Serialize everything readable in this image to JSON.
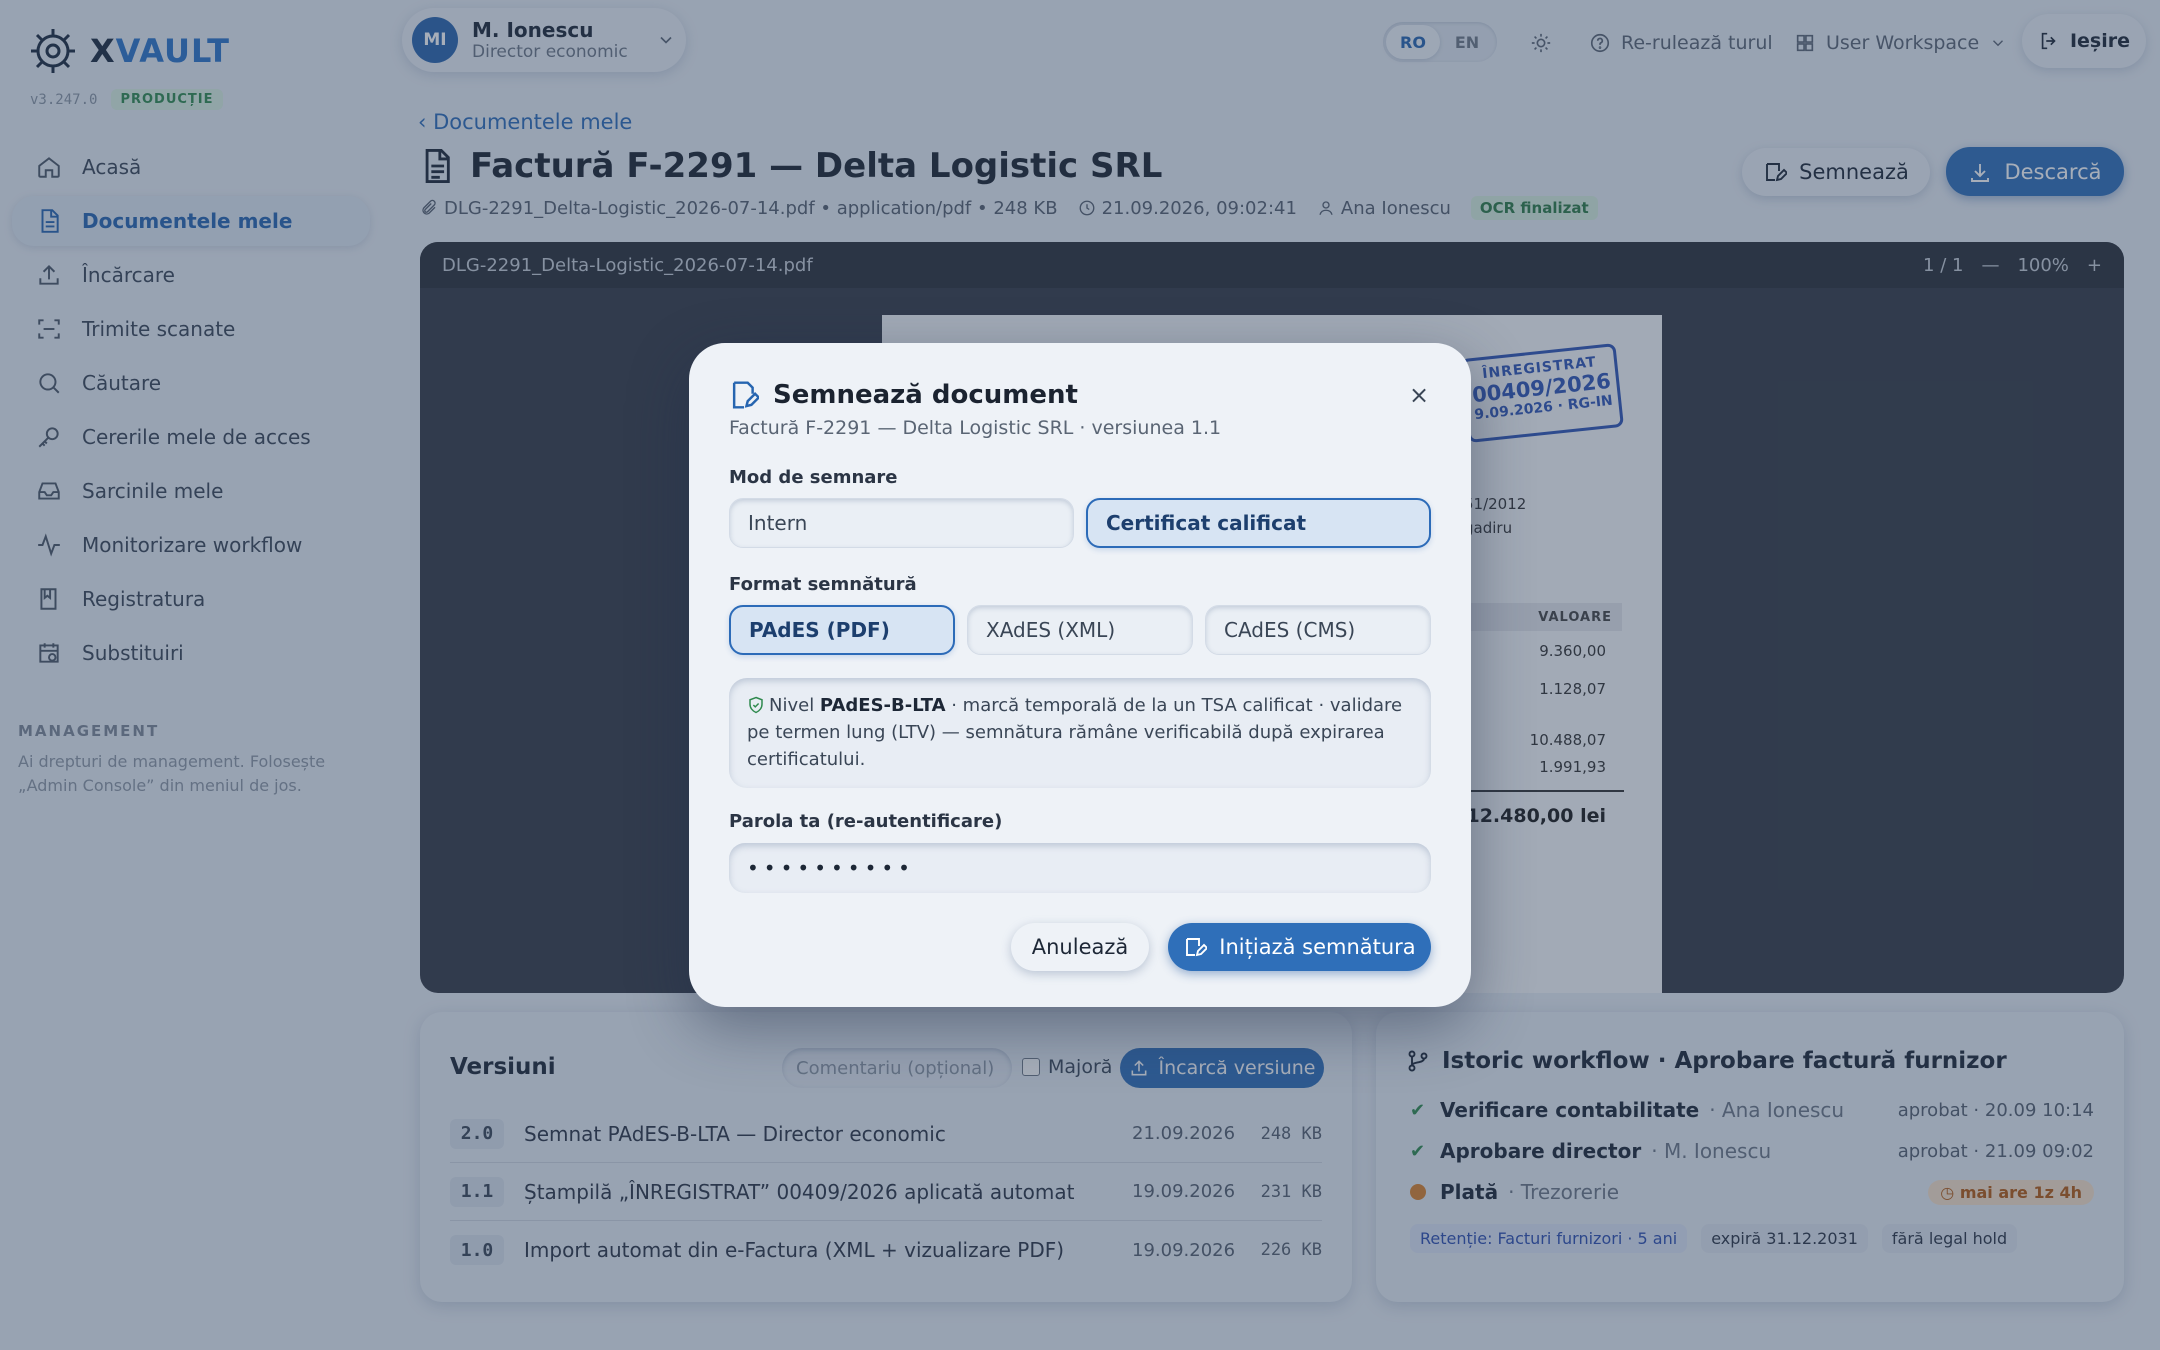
{
  "brand": {
    "prefix": "X",
    "name": "VAULT",
    "version": "v3.247.0",
    "env": "PRODUCȚIE"
  },
  "sidebar": {
    "items": [
      {
        "label": "Acasă",
        "icon": "home-icon"
      },
      {
        "label": "Documentele mele",
        "icon": "document-icon",
        "active": true
      },
      {
        "label": "Încărcare",
        "icon": "upload-icon"
      },
      {
        "label": "Trimite scanate",
        "icon": "scan-icon"
      },
      {
        "label": "Căutare",
        "icon": "search-icon"
      },
      {
        "label": "Cererile mele de acces",
        "icon": "key-icon"
      },
      {
        "label": "Sarcinile mele",
        "icon": "inbox-icon"
      },
      {
        "label": "Monitorizare workflow",
        "icon": "activity-icon"
      },
      {
        "label": "Registratura",
        "icon": "book-icon"
      },
      {
        "label": "Substituiri",
        "icon": "calendar-clock-icon"
      }
    ],
    "management": {
      "title": "MANAGEMENT",
      "desc": "Ai drepturi de management. Folosește „Admin Console” din meniul de jos."
    }
  },
  "header": {
    "user": {
      "initials": "MI",
      "name": "M. Ionescu",
      "role": "Director economic"
    },
    "langs": [
      "RO",
      "EN"
    ],
    "active_lang": "RO",
    "replay": "Re-rulează turul",
    "workspace": "User Workspace",
    "exit": "Ieșire"
  },
  "doc": {
    "back": "‹ Documentele mele",
    "title": "Factură F-2291 — Delta Logistic SRL",
    "meta_file": "DLG-2291_Delta-Logistic_2026-07-14.pdf • application/pdf • 248 KB",
    "meta_time": "21.09.2026, 09:02:41",
    "meta_user": "Ana Ionescu",
    "ocr": "OCR finalizat",
    "sign_label": "Semnează",
    "download_label": "Descarcă"
  },
  "viewer": {
    "filename": "DLG-2291_Delta-Logistic_2026-07-14.pdf",
    "pages": "1 / 1",
    "zoom_out": "—",
    "zoom": "100%",
    "zoom_in": "+",
    "stamp": {
      "l1": "ÎNREGISTRAT",
      "l2": "00409/2026",
      "l3": "9.09.2026 · RG-IN"
    },
    "frag1": "51/2012",
    "frag2": "gadiru",
    "col": "VALOARE",
    "values": [
      "9.360,00",
      "1.128,07",
      "10.488,07",
      "1.991,93"
    ],
    "total": "12.480,00 lei"
  },
  "versions": {
    "title": "Versiuni",
    "comment_placeholder": "Comentariu (opțional)",
    "major": "Majoră",
    "upload": "Încarcă versiune",
    "rows": [
      {
        "num": "2.0",
        "desc": "Semnat PAdES-B-LTA — Director economic",
        "date": "21.09.2026",
        "size": "248 KB"
      },
      {
        "num": "1.1",
        "desc": "Ștampilă „ÎNREGISTRAT” 00409/2026 aplicată automat",
        "date": "19.09.2026",
        "size": "231 KB"
      },
      {
        "num": "1.0",
        "desc": "Import automat din e-Factura (XML + vizualizare PDF)",
        "date": "19.09.2026",
        "size": "226 KB"
      }
    ]
  },
  "workflow": {
    "title": "Istoric workflow · Aprobare factură furnizor",
    "rows": [
      {
        "step": "Verificare contabilitate",
        "who": "· Ana Ionescu",
        "status": "aprobat · 20.09 10:14"
      },
      {
        "step": "Aprobare director",
        "who": "· M. Ionescu",
        "status": "aprobat · 21.09 09:02"
      },
      {
        "step": "Plată",
        "who": "· Trezorerie",
        "status": "mai are 1z 4h"
      }
    ],
    "tags": [
      "Retenție: Facturi furnizori · 5 ani",
      "expiră 31.12.2031",
      "fără legal hold"
    ]
  },
  "modal": {
    "title": "Semnează document",
    "subtitle": "Factură F-2291 — Delta Logistic SRL · versiunea 1.1",
    "close": "×",
    "mode_label": "Mod de semnare",
    "modes": [
      "Intern",
      "Certificat calificat"
    ],
    "mode_selected": "Certificat calificat",
    "format_label": "Format semnătură",
    "formats": [
      "PAdES (PDF)",
      "XAdES (XML)",
      "CAdES (CMS)"
    ],
    "format_selected": "PAdES (PDF)",
    "info_pre": "Nivel ",
    "info_level": "PAdES-B-LTA",
    "info_post": " · marcă temporală de la un TSA calificat · validare pe termen lung (LTV) — semnătura rămâne verificabilă după expirarea certificatului.",
    "pwd_label": "Parola ta (re-autentificare)",
    "pwd_value": "••••••••••",
    "cancel": "Anulează",
    "submit": "Inițiază semnătura"
  },
  "colors": {
    "accent": "#2f6fb9",
    "success": "#2f8a4e",
    "warning": "#d9822b"
  }
}
